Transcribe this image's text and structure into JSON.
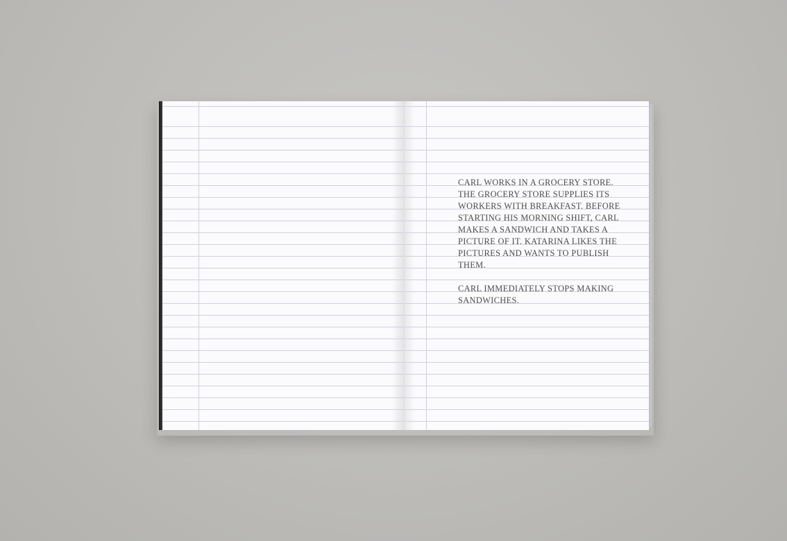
{
  "book": {
    "right_page": {
      "paragraphs": [
        "CARL WORKS IN A GROCERY STORE. THE GROCERY STORE SUPPLIES ITS WORKERS WITH BREAKFAST. BEFORE STARTING HIS MORNING SHIFT, CARL MAKES A SANDWICH AND TAKES A PICTURE OF IT. KATARINA LIKES THE PICTURES AND WANTS TO PUBLISH THEM.",
        "CARL IMMEDIATELY STOPS MAKING SANDWICHES."
      ]
    }
  },
  "colors": {
    "background": "#c2c1be",
    "paper": "#fbfbfd",
    "rule_lines": "#cfd1dc",
    "text": "#4b4b4b",
    "spine": "#1b1b1b"
  }
}
